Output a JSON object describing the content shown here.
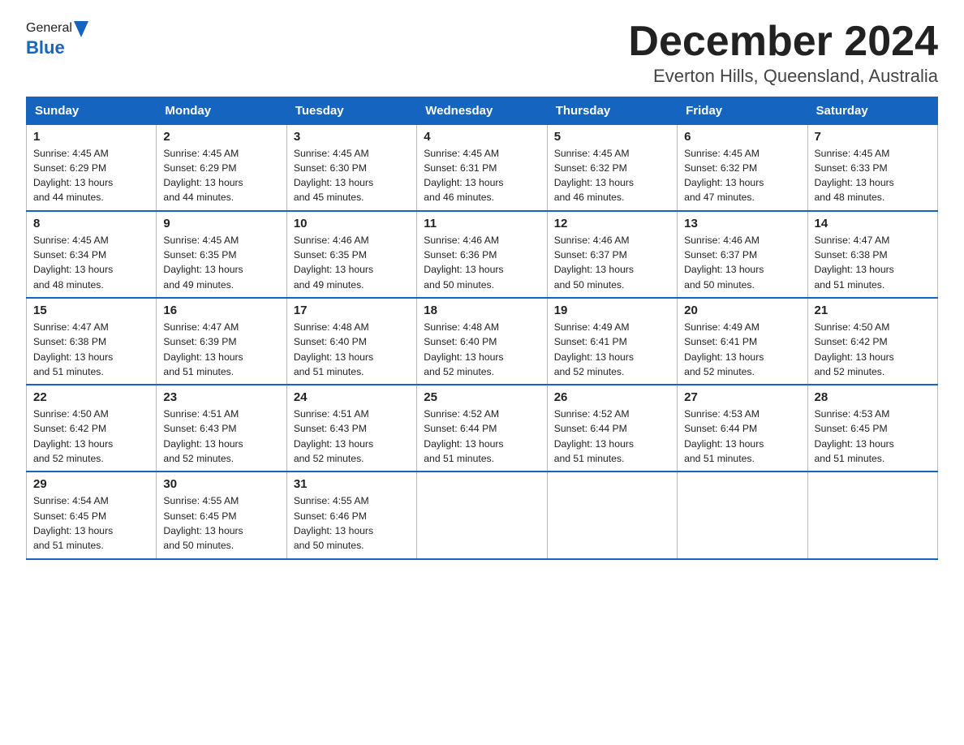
{
  "header": {
    "logo_general": "General",
    "logo_blue": "Blue",
    "title": "December 2024",
    "subtitle": "Everton Hills, Queensland, Australia"
  },
  "calendar": {
    "days_of_week": [
      "Sunday",
      "Monday",
      "Tuesday",
      "Wednesday",
      "Thursday",
      "Friday",
      "Saturday"
    ],
    "weeks": [
      [
        {
          "date": "1",
          "sunrise": "4:45 AM",
          "sunset": "6:29 PM",
          "daylight": "13 hours and 44 minutes."
        },
        {
          "date": "2",
          "sunrise": "4:45 AM",
          "sunset": "6:29 PM",
          "daylight": "13 hours and 44 minutes."
        },
        {
          "date": "3",
          "sunrise": "4:45 AM",
          "sunset": "6:30 PM",
          "daylight": "13 hours and 45 minutes."
        },
        {
          "date": "4",
          "sunrise": "4:45 AM",
          "sunset": "6:31 PM",
          "daylight": "13 hours and 46 minutes."
        },
        {
          "date": "5",
          "sunrise": "4:45 AM",
          "sunset": "6:32 PM",
          "daylight": "13 hours and 46 minutes."
        },
        {
          "date": "6",
          "sunrise": "4:45 AM",
          "sunset": "6:32 PM",
          "daylight": "13 hours and 47 minutes."
        },
        {
          "date": "7",
          "sunrise": "4:45 AM",
          "sunset": "6:33 PM",
          "daylight": "13 hours and 48 minutes."
        }
      ],
      [
        {
          "date": "8",
          "sunrise": "4:45 AM",
          "sunset": "6:34 PM",
          "daylight": "13 hours and 48 minutes."
        },
        {
          "date": "9",
          "sunrise": "4:45 AM",
          "sunset": "6:35 PM",
          "daylight": "13 hours and 49 minutes."
        },
        {
          "date": "10",
          "sunrise": "4:46 AM",
          "sunset": "6:35 PM",
          "daylight": "13 hours and 49 minutes."
        },
        {
          "date": "11",
          "sunrise": "4:46 AM",
          "sunset": "6:36 PM",
          "daylight": "13 hours and 50 minutes."
        },
        {
          "date": "12",
          "sunrise": "4:46 AM",
          "sunset": "6:37 PM",
          "daylight": "13 hours and 50 minutes."
        },
        {
          "date": "13",
          "sunrise": "4:46 AM",
          "sunset": "6:37 PM",
          "daylight": "13 hours and 50 minutes."
        },
        {
          "date": "14",
          "sunrise": "4:47 AM",
          "sunset": "6:38 PM",
          "daylight": "13 hours and 51 minutes."
        }
      ],
      [
        {
          "date": "15",
          "sunrise": "4:47 AM",
          "sunset": "6:38 PM",
          "daylight": "13 hours and 51 minutes."
        },
        {
          "date": "16",
          "sunrise": "4:47 AM",
          "sunset": "6:39 PM",
          "daylight": "13 hours and 51 minutes."
        },
        {
          "date": "17",
          "sunrise": "4:48 AM",
          "sunset": "6:40 PM",
          "daylight": "13 hours and 51 minutes."
        },
        {
          "date": "18",
          "sunrise": "4:48 AM",
          "sunset": "6:40 PM",
          "daylight": "13 hours and 52 minutes."
        },
        {
          "date": "19",
          "sunrise": "4:49 AM",
          "sunset": "6:41 PM",
          "daylight": "13 hours and 52 minutes."
        },
        {
          "date": "20",
          "sunrise": "4:49 AM",
          "sunset": "6:41 PM",
          "daylight": "13 hours and 52 minutes."
        },
        {
          "date": "21",
          "sunrise": "4:50 AM",
          "sunset": "6:42 PM",
          "daylight": "13 hours and 52 minutes."
        }
      ],
      [
        {
          "date": "22",
          "sunrise": "4:50 AM",
          "sunset": "6:42 PM",
          "daylight": "13 hours and 52 minutes."
        },
        {
          "date": "23",
          "sunrise": "4:51 AM",
          "sunset": "6:43 PM",
          "daylight": "13 hours and 52 minutes."
        },
        {
          "date": "24",
          "sunrise": "4:51 AM",
          "sunset": "6:43 PM",
          "daylight": "13 hours and 52 minutes."
        },
        {
          "date": "25",
          "sunrise": "4:52 AM",
          "sunset": "6:44 PM",
          "daylight": "13 hours and 51 minutes."
        },
        {
          "date": "26",
          "sunrise": "4:52 AM",
          "sunset": "6:44 PM",
          "daylight": "13 hours and 51 minutes."
        },
        {
          "date": "27",
          "sunrise": "4:53 AM",
          "sunset": "6:44 PM",
          "daylight": "13 hours and 51 minutes."
        },
        {
          "date": "28",
          "sunrise": "4:53 AM",
          "sunset": "6:45 PM",
          "daylight": "13 hours and 51 minutes."
        }
      ],
      [
        {
          "date": "29",
          "sunrise": "4:54 AM",
          "sunset": "6:45 PM",
          "daylight": "13 hours and 51 minutes."
        },
        {
          "date": "30",
          "sunrise": "4:55 AM",
          "sunset": "6:45 PM",
          "daylight": "13 hours and 50 minutes."
        },
        {
          "date": "31",
          "sunrise": "4:55 AM",
          "sunset": "6:46 PM",
          "daylight": "13 hours and 50 minutes."
        },
        null,
        null,
        null,
        null
      ]
    ],
    "sunrise_label": "Sunrise:",
    "sunset_label": "Sunset:",
    "daylight_label": "Daylight:"
  }
}
